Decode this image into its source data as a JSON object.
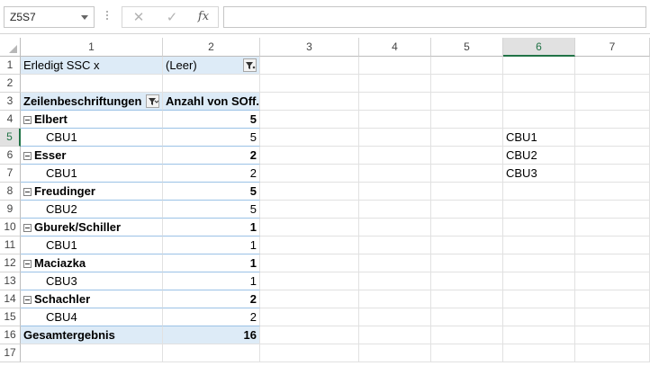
{
  "formula_bar": {
    "name_box": "Z5S7",
    "cancel_glyph": "✕",
    "enter_glyph": "✓",
    "fx_label": "fx",
    "formula": ""
  },
  "columns": [
    "1",
    "2",
    "3",
    "4",
    "5",
    "6",
    "7"
  ],
  "selected_column": "6",
  "rows": [
    "1",
    "2",
    "3",
    "4",
    "5",
    "6",
    "7",
    "8",
    "9",
    "10",
    "11",
    "12",
    "13",
    "14",
    "15",
    "16",
    "17"
  ],
  "selected_row": "5",
  "pivot": {
    "filter_field": "Erledigt SSC x",
    "filter_value": "(Leer)",
    "row_labels_header": "Zeilenbeschriftungen",
    "value_header": "Anzahl von SOff.",
    "groups": [
      {
        "name": "Elbert",
        "total": "5",
        "item": "CBU1",
        "item_value": "5"
      },
      {
        "name": "Esser",
        "total": "2",
        "item": "CBU1",
        "item_value": "2"
      },
      {
        "name": "Freudinger",
        "total": "5",
        "item": "CBU2",
        "item_value": "5"
      },
      {
        "name": "Gburek/Schiller",
        "total": "1",
        "item": "CBU1",
        "item_value": "1"
      },
      {
        "name": "Maciazka",
        "total": "1",
        "item": "CBU3",
        "item_value": "1"
      },
      {
        "name": "Schachler",
        "total": "2",
        "item": "CBU4",
        "item_value": "2"
      }
    ],
    "grand_total_label": "Gesamtergebnis",
    "grand_total_value": "16"
  },
  "side_list": [
    "CBU1",
    "CBU2",
    "CBU3"
  ],
  "icons": {
    "collapse": "minus-box-icon",
    "filter": "filter-icon",
    "name_box_dropdown": "chevron-down-icon",
    "cancel": "close-icon",
    "enter": "check-icon",
    "function": "fx-icon"
  },
  "colors": {
    "pivot_header_fill": "#ddebf7",
    "pivot_row_line": "#9bc2e6",
    "selection": "#217346"
  }
}
